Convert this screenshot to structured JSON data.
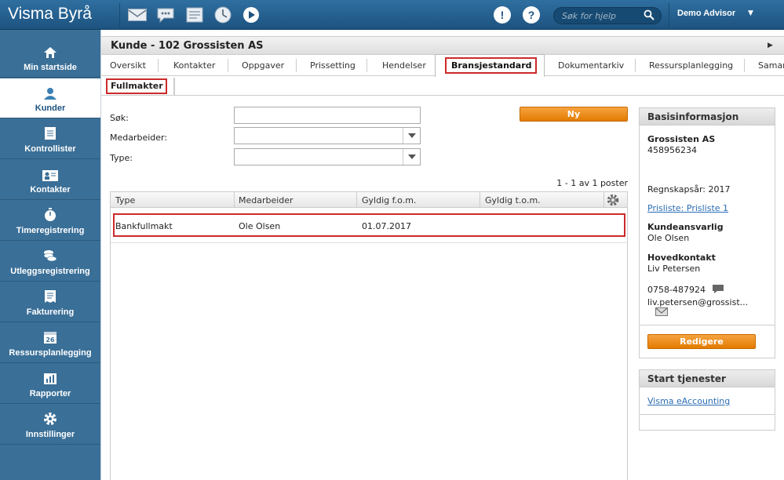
{
  "app": {
    "title": "Visma Byrå",
    "user": "Demo Advisor",
    "help_search_placeholder": "Søk for hjelp"
  },
  "sidebar": {
    "items": [
      {
        "label": "Min startside",
        "icon": "home-icon"
      },
      {
        "label": "Kunder",
        "icon": "person-icon",
        "active": true
      },
      {
        "label": "Kontrollister",
        "icon": "checklist-icon"
      },
      {
        "label": "Kontakter",
        "icon": "contact-card-icon"
      },
      {
        "label": "Timeregistrering",
        "icon": "stopwatch-icon"
      },
      {
        "label": "Utleggsregistrering",
        "icon": "coins-icon"
      },
      {
        "label": "Fakturering",
        "icon": "invoice-icon"
      },
      {
        "label": "Ressursplanlegging",
        "icon": "calendar-icon",
        "calendar_day": "26"
      },
      {
        "label": "Rapporter",
        "icon": "bar-chart-icon"
      },
      {
        "label": "Innstillinger",
        "icon": "gear-icon"
      }
    ]
  },
  "page": {
    "title": "Kunde - 102 Grossisten AS"
  },
  "tabs": [
    "Oversikt",
    "Kontakter",
    "Oppgaver",
    "Prissetting",
    "Hendelser",
    "Bransjestandard",
    "Dokumentarkiv",
    "Ressursplanlegging",
    "Samar"
  ],
  "subtab": "Fullmakter",
  "filters": {
    "search_label": "Søk:",
    "employee_label": "Medarbeider:",
    "type_label": "Type:",
    "search_value": "",
    "employee_value": "",
    "type_value": ""
  },
  "new_button": "Ny",
  "pager": "1 - 1 av 1 poster",
  "table": {
    "columns": [
      "Type",
      "Medarbeider",
      "Gyldig f.o.m.",
      "Gyldig t.o.m."
    ],
    "rows": [
      [
        "Bankfullmakt",
        "Ole Olsen",
        "01.07.2017",
        ""
      ]
    ]
  },
  "basis": {
    "title": "Basisinformasjon",
    "company": "Grossisten AS",
    "org_number": "458956234",
    "fiscal_year": "Regnskapsår: 2017",
    "price_list": "Prisliste: Prisliste 1",
    "account_manager_label": "Kundeansvarlig",
    "account_manager": "Ole Olsen",
    "main_contact_label": "Hovedkontakt",
    "main_contact": "Liv Petersen",
    "phone": "0758-487924",
    "email": "liv.petersen@grossist...",
    "edit_button": "Redigere"
  },
  "services": {
    "title": "Start tjenester",
    "link": "Visma eAccounting"
  },
  "colors": {
    "topbar": "#1d5380",
    "sidebar": "#3a6f97",
    "accent_orange": "#e27b00",
    "highlight_red": "#cc2a2a",
    "link": "#2a6db5"
  }
}
